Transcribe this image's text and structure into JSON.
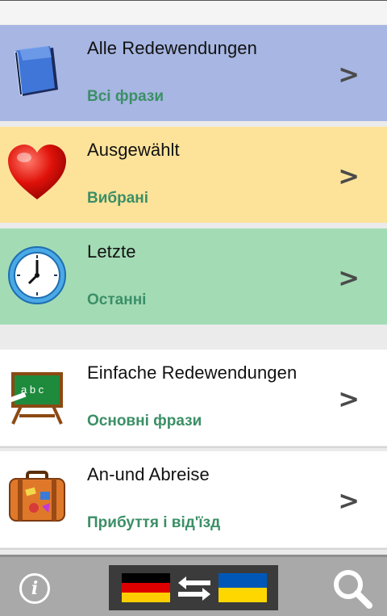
{
  "menu": {
    "all": {
      "title": "Alle Redewendungen",
      "subtitle": "Всі фрази",
      "arrow": ">",
      "icon": "book-icon"
    },
    "favorites": {
      "title": "Ausgewählt",
      "subtitle": "Вибрані",
      "arrow": ">",
      "icon": "heart-icon"
    },
    "recent": {
      "title": "Letzte",
      "subtitle": "Останні",
      "arrow": ">",
      "icon": "clock-icon"
    },
    "basic": {
      "title": "Einfache Redewendungen",
      "subtitle": "Основні фрази",
      "arrow": ">",
      "icon": "chalkboard-icon"
    },
    "travel": {
      "title": "An-und Abreise",
      "subtitle": "Прибуття і від'їзд",
      "arrow": ">",
      "icon": "suitcase-icon"
    }
  },
  "bottom_bar": {
    "info_label": "i",
    "info_icon": "info-icon",
    "language_switch_icons": [
      "german-flag-icon",
      "swap-arrows-icon",
      "ukrainian-flag-icon"
    ],
    "search_icon": "search-icon"
  },
  "colors": {
    "row_all": "#a7b6e2",
    "row_favorites": "#fde39a",
    "row_recent": "#a3dbb5",
    "subtitle_green": "#3b8f66",
    "bottom_bar": "#a9a9a9"
  }
}
